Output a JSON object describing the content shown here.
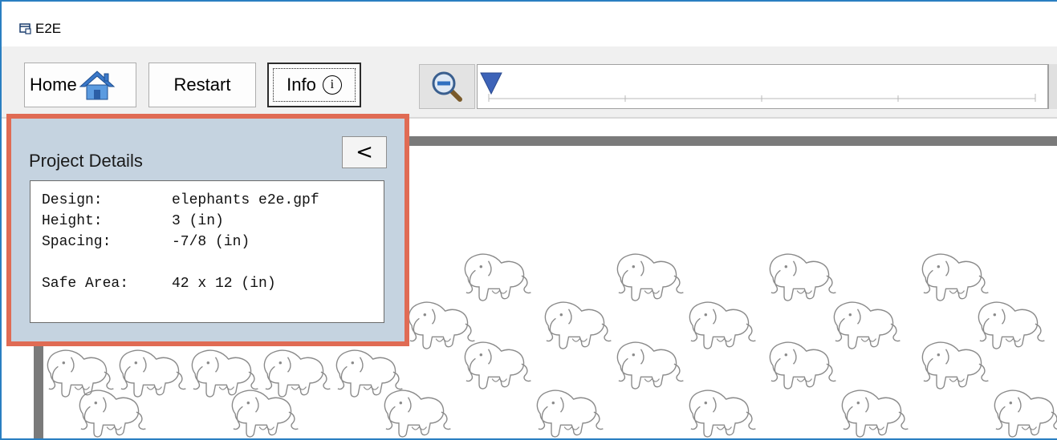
{
  "window": {
    "title": "E2E"
  },
  "toolbar": {
    "home_label": "Home",
    "restart_label": "Restart",
    "info_label": "Info",
    "info_icon_glyph": "i"
  },
  "panel": {
    "title": "Project Details",
    "collapse_label": "<",
    "details": [
      {
        "key": "Design:",
        "value": "elephants e2e.gpf"
      },
      {
        "key": "Height:",
        "value": "3 (in)"
      },
      {
        "key": "Spacing:",
        "value": "-7/8 (in)"
      },
      {
        "key": "",
        "value": ""
      },
      {
        "key": "Safe Area:",
        "value": "42 x 12 (in)"
      }
    ]
  },
  "icons": {
    "app": "window-icon",
    "home": "house-icon",
    "info": "info-circle-icon",
    "zoom": "zoom-out-icon",
    "slider_thumb": "triangle-marker-icon"
  },
  "colors": {
    "window_border": "#2a7fc1",
    "panel_bg": "#c5d3e0",
    "panel_highlight": "#e06b54",
    "canvas_frame": "#7a7a7a",
    "slider_thumb": "#3d63b8"
  },
  "zoom_slider": {
    "position": 0
  }
}
